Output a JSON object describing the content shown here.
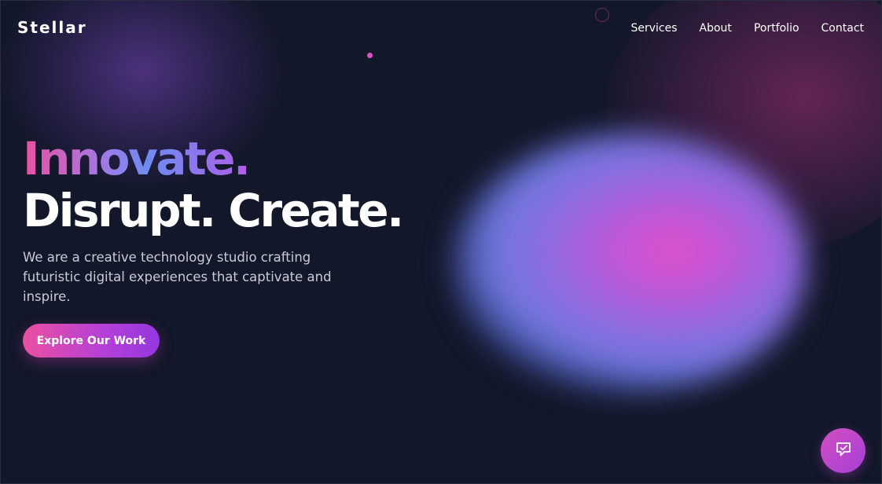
{
  "brand": {
    "name": "Stellar"
  },
  "nav": {
    "items": [
      {
        "label": "Services"
      },
      {
        "label": "About"
      },
      {
        "label": "Portfolio"
      },
      {
        "label": "Contact"
      }
    ]
  },
  "hero": {
    "headline_line1": "Innovate.",
    "headline_line2": "Disrupt. Create.",
    "subtitle": "We are a creative technology studio crafting futuristic digital experiences that captivate and inspire.",
    "cta_label": "Explore Our Work"
  },
  "chat": {
    "icon": "chat-bubble-icon"
  },
  "colors": {
    "background": "#121729",
    "accent_pink": "#ea4fa0",
    "accent_purple": "#9437e0",
    "accent_blue": "#6d8cf0"
  }
}
